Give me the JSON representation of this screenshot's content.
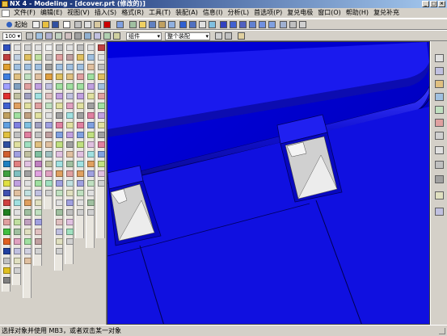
{
  "titlebar": {
    "title": "NX 4 - Modeling - [dcover.prt (修改的)]",
    "min": "_",
    "max": "□",
    "close": "×"
  },
  "menu": {
    "items": [
      "文件(F)",
      "编辑(E)",
      "视图(V)",
      "插入(S)",
      "格式(R)",
      "工具(T)",
      "装配(A)",
      "信息(I)",
      "分析(L)",
      "首选项(P)",
      "复兑电极",
      "窗口(O)",
      "帮助(H)",
      "复兑补充"
    ]
  },
  "toolbar": {
    "start_label": "起始",
    "zoom_value": "100",
    "filter_value": "组件",
    "scope_value": "整个装配"
  },
  "status": {
    "prompt": "选择对象并使用 MB3，或者双击某一对象"
  },
  "colors": {
    "viewport_bg": "#0000cc",
    "part_blue": "#1414e6",
    "clip_gray": "#d8d8d8",
    "title_start": "#0a246a",
    "title_end": "#a6caf0"
  }
}
